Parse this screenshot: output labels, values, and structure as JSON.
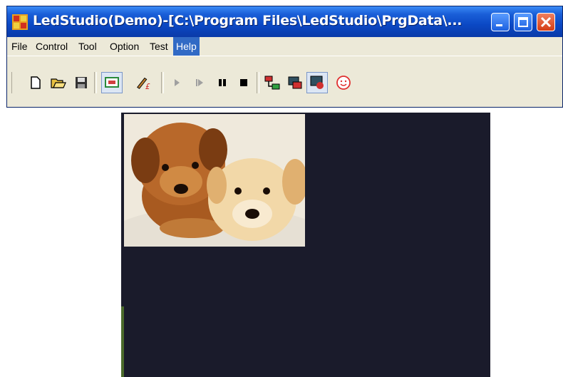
{
  "window": {
    "title": "LedStudio(Demo)-[C:\\Program Files\\LedStudio\\PrgData\\..."
  },
  "menu": {
    "items": [
      "File",
      "Control",
      "Tool",
      "Option",
      "Test",
      "Help"
    ],
    "active": "Help"
  },
  "toolbar": {
    "buttons": [
      "new-icon",
      "open-icon",
      "save-icon",
      "screen-icon",
      "edit-icon",
      "play-icon",
      "step-icon",
      "pause-icon",
      "stop-icon",
      "connect-icon",
      "send-icon",
      "record-icon",
      "smiley-icon"
    ]
  },
  "colors": {
    "titlebar": "#0b48c4",
    "canvas": "#1a1b2b",
    "menu_highlight": "#316ac5"
  }
}
